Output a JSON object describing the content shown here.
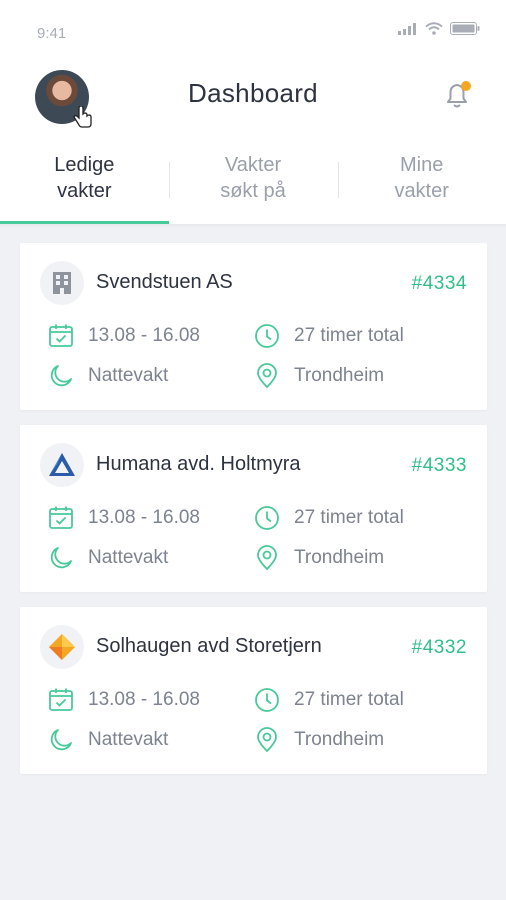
{
  "status_bar": {
    "time": "9:41"
  },
  "header": {
    "title": "Dashboard",
    "notification_badge_color": "#f5a623"
  },
  "tabs": [
    {
      "line1": "Ledige",
      "line2": "vakter",
      "active": true
    },
    {
      "line1": "Vakter",
      "line2": "søkt på",
      "active": false
    },
    {
      "line1": "Mine",
      "line2": "vakter",
      "active": false
    }
  ],
  "colors": {
    "accent": "#2fbf8a",
    "icon": "#48c99a",
    "background": "#eff1f5"
  },
  "shifts": [
    {
      "org": "Svendstuen AS",
      "id": "#4334",
      "logo": "building-icon",
      "dates": "13.08 - 16.08",
      "hours": "27 timer total",
      "type": "Nattevakt",
      "location": "Trondheim"
    },
    {
      "org": "Humana avd. Holtmyra",
      "id": "#4333",
      "logo": "triangle-logo-icon",
      "dates": "13.08 - 16.08",
      "hours": "27 timer total",
      "type": "Nattevakt",
      "location": "Trondheim"
    },
    {
      "org": "Solhaugen avd Storetjern",
      "id": "#4332",
      "logo": "diamond-logo-icon",
      "dates": "13.08 - 16.08",
      "hours": "27 timer total",
      "type": "Nattevakt",
      "location": "Trondheim"
    }
  ]
}
